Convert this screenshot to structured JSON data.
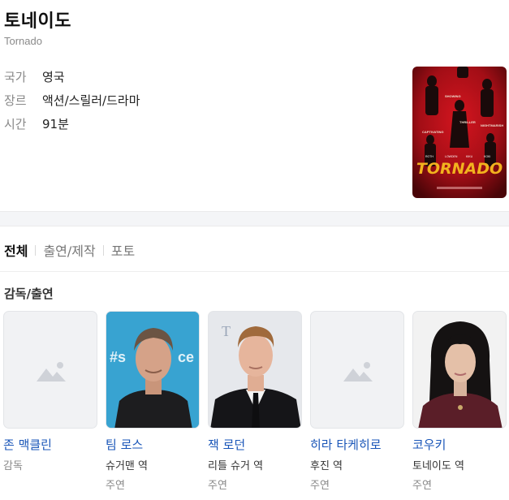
{
  "movie": {
    "title": "토네이도",
    "original_title": "Tornado",
    "info": [
      {
        "key": "국가",
        "value": "영국"
      },
      {
        "key": "장르",
        "value": "액션/스릴러/드라마"
      },
      {
        "key": "시간",
        "value": "91분"
      }
    ],
    "poster_title": "TORNADO"
  },
  "tabs": [
    "전체",
    "출연/제작",
    "포토"
  ],
  "cast_section_title": "감독/출연",
  "cast": [
    {
      "name": "존 맥클린",
      "role": "감독",
      "type": ""
    },
    {
      "name": "팀 로스",
      "role": "슈거맨 역",
      "type": "주연"
    },
    {
      "name": "잭 로던",
      "role": "리틀 슈거 역",
      "type": "주연"
    },
    {
      "name": "히라 타케히로",
      "role": "후진 역",
      "type": "주연"
    },
    {
      "name": "코우키",
      "role": "토네이도 역",
      "type": "주연"
    }
  ],
  "colors": {
    "link": "#1a56b8",
    "poster_red": "#b3121a",
    "poster_title": "#f2b21e"
  }
}
